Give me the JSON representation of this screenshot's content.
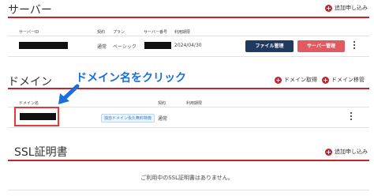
{
  "server": {
    "title": "サーバー",
    "add_link": "追加申し込み",
    "headers": [
      "サーバーID",
      "契約",
      "プラン",
      "サーバー番号",
      "利用期限"
    ],
    "row": {
      "contract": "通常",
      "plan": "ベーシック",
      "expiry": "2024/04/30"
    },
    "file_button": "ファイル管理",
    "server_button": "サーバー管理"
  },
  "domain": {
    "title": "ドメイン",
    "annotation": "ドメイン名をクリック",
    "get_link": "ドメイン取得",
    "transfer_link": "ドメイン移管",
    "headers": [
      "ドメイン名",
      "契約",
      "利用期限"
    ],
    "row": {
      "tag": "独自ドメイン永久無料特典",
      "contract": "通常"
    }
  },
  "ssl": {
    "title": "SSL証明書",
    "add_link": "追加申し込み",
    "empty_message": "ご利用中のSSL証明書はありません。"
  },
  "colors": {
    "accent_red": "#c8232c",
    "navy": "#1f3a5f",
    "button_red": "#e05a5f",
    "annotation_blue": "#1b6fd8"
  }
}
